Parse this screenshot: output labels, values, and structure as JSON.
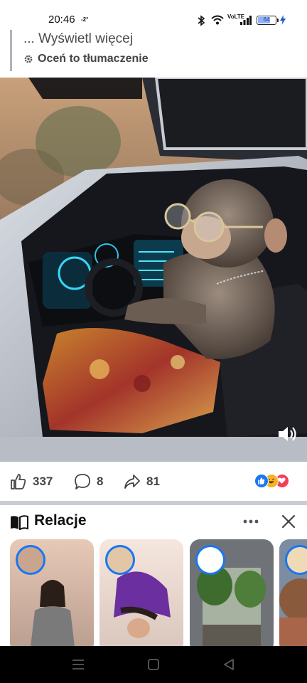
{
  "status_bar": {
    "time": "20:46",
    "sub_indicator": "-2°",
    "network": "VoLTE",
    "battery": "64"
  },
  "post": {
    "see_more": "... Wyświetl więcej",
    "rate_translation": "Oceń to tłumaczenie"
  },
  "actions": {
    "likes": "337",
    "comments": "8",
    "shares": "81"
  },
  "reactions": [
    "like",
    "haha",
    "love"
  ],
  "stories": {
    "title": "Relacje",
    "items": [
      {
        "name": "story-1"
      },
      {
        "name": "story-2"
      },
      {
        "name": "story-3"
      },
      {
        "name": "story-4"
      }
    ]
  },
  "colors": {
    "accent": "#1877f2",
    "love": "#f33e58",
    "haha": "#f7b125"
  }
}
